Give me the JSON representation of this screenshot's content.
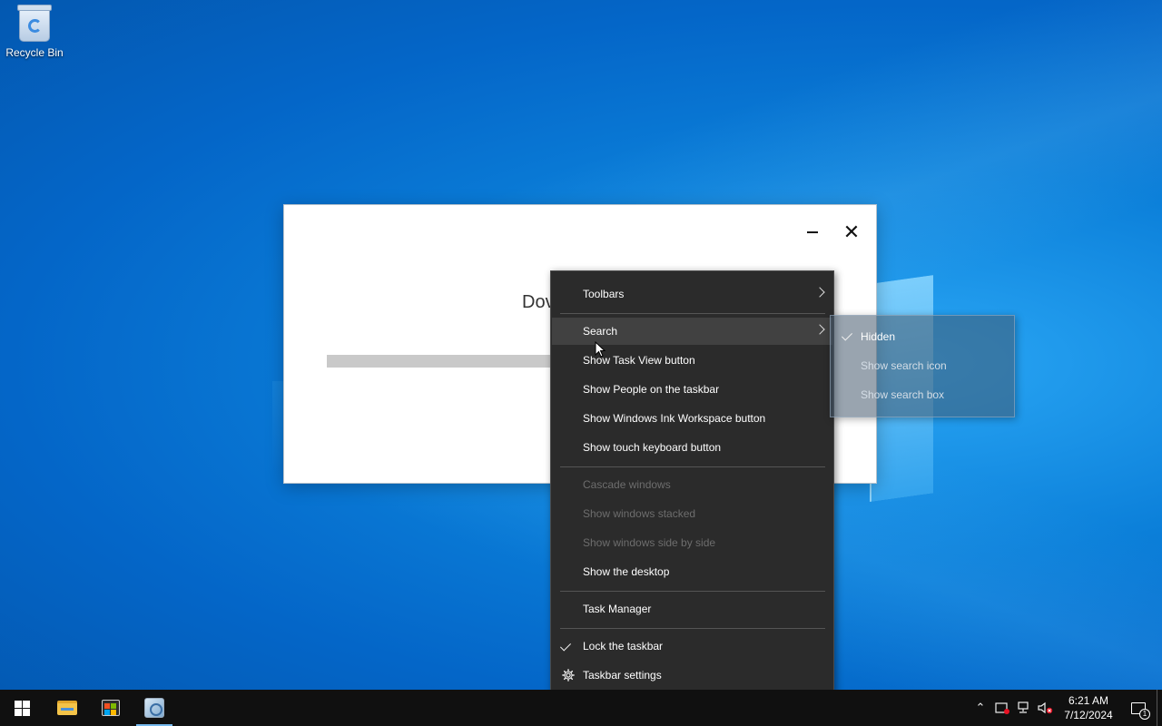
{
  "desktop": {
    "icons": [
      {
        "label": "Recycle Bin",
        "icon": "recycle-bin-icon"
      }
    ]
  },
  "dialog": {
    "title_partial": "Dov",
    "progress": 0.48
  },
  "context_menu": {
    "items": [
      {
        "label": "Toolbars",
        "submenu": true
      },
      {
        "label": "Search",
        "submenu": true,
        "hover": true
      },
      {
        "label": "Show Task View button"
      },
      {
        "label": "Show People on the taskbar"
      },
      {
        "label": "Show Windows Ink Workspace button"
      },
      {
        "label": "Show touch keyboard button"
      },
      {
        "label": "Cascade windows",
        "disabled": true
      },
      {
        "label": "Show windows stacked",
        "disabled": true
      },
      {
        "label": "Show windows side by side",
        "disabled": true
      },
      {
        "label": "Show the desktop"
      },
      {
        "label": "Task Manager"
      },
      {
        "label": "Lock the taskbar",
        "checked": true
      },
      {
        "label": "Taskbar settings",
        "icon": "gear-icon"
      }
    ]
  },
  "search_submenu": {
    "items": [
      {
        "label": "Hidden",
        "checked": true
      },
      {
        "label": "Show search icon"
      },
      {
        "label": "Show search box"
      }
    ]
  },
  "taskbar": {
    "pinned": [
      {
        "name": "start",
        "icon": "windows-logo-icon"
      },
      {
        "name": "file-explorer",
        "icon": "folder-icon"
      },
      {
        "name": "microsoft-store",
        "icon": "store-icon"
      },
      {
        "name": "installer-app",
        "icon": "app-icon",
        "active": true
      }
    ],
    "tray": {
      "time": "6:21 AM",
      "date": "7/12/2024",
      "notification_count": "1"
    }
  },
  "colors": {
    "menu_bg": "#2b2b2b",
    "menu_hover": "#414141",
    "taskbar_bg": "#101010",
    "accent": "#76b9ed"
  }
}
